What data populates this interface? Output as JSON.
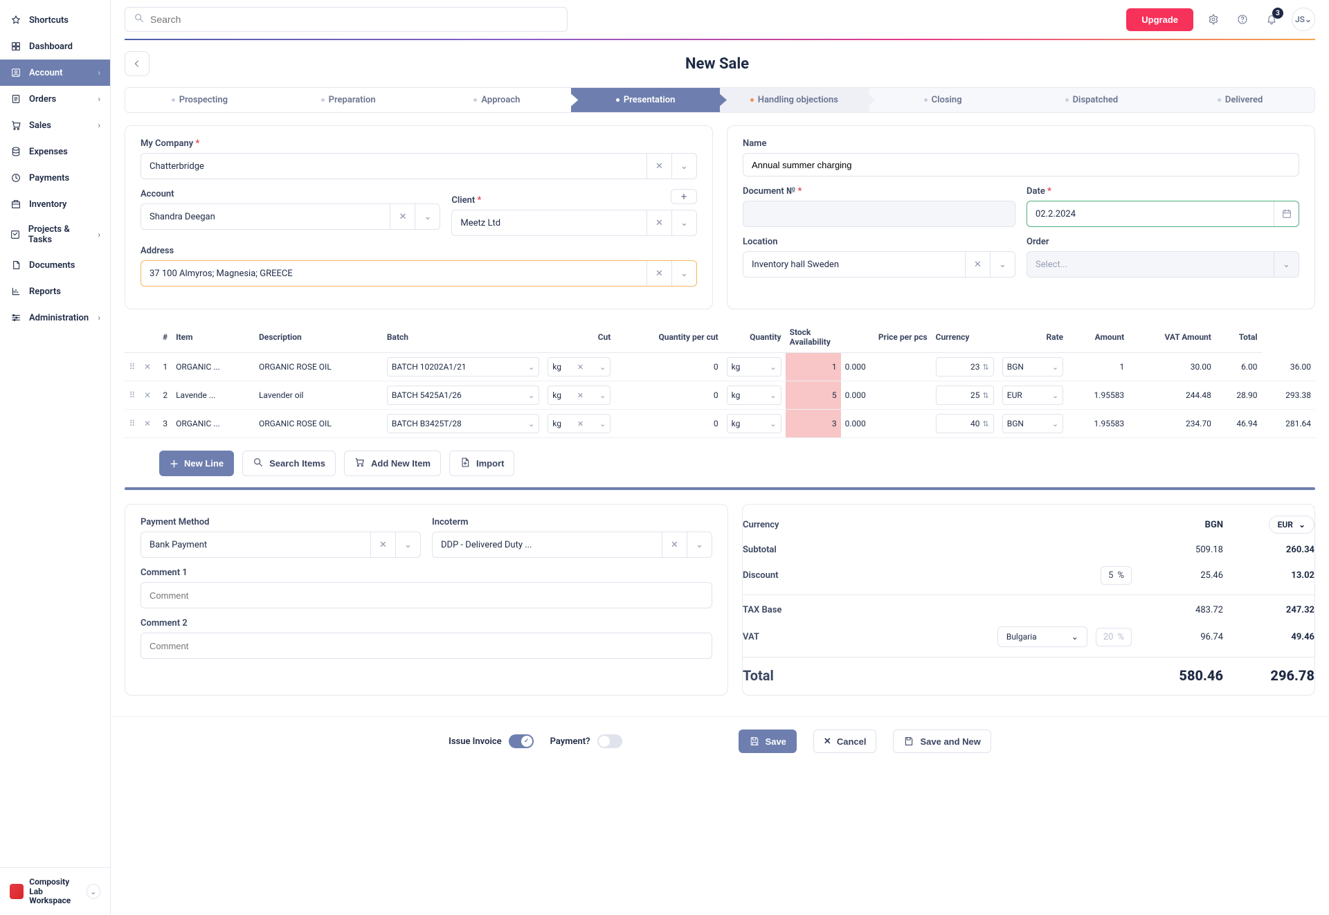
{
  "topbar": {
    "search_placeholder": "Search",
    "upgrade": "Upgrade",
    "notif_count": "3",
    "avatar": "JS"
  },
  "sidebar": {
    "items": [
      {
        "label": "Shortcuts",
        "has_children": false
      },
      {
        "label": "Dashboard",
        "has_children": false
      },
      {
        "label": "Account",
        "has_children": true,
        "active": true
      },
      {
        "label": "Orders",
        "has_children": true
      },
      {
        "label": "Sales",
        "has_children": true
      },
      {
        "label": "Expenses",
        "has_children": false
      },
      {
        "label": "Payments",
        "has_children": false
      },
      {
        "label": "Inventory",
        "has_children": false
      },
      {
        "label": "Projects & Tasks",
        "has_children": true
      },
      {
        "label": "Documents",
        "has_children": false
      },
      {
        "label": "Reports",
        "has_children": false
      },
      {
        "label": "Administration",
        "has_children": true
      }
    ],
    "workspace_line1": "Composity Lab",
    "workspace_line2": "Workspace"
  },
  "page": {
    "title": "New Sale"
  },
  "steps": [
    "Prospecting",
    "Preparation",
    "Approach",
    "Presentation",
    "Handling objections",
    "Closing",
    "Dispatched",
    "Delivered"
  ],
  "form": {
    "my_company_label": "My Company",
    "my_company_value": "Chatterbridge",
    "account_label": "Account",
    "account_value": "Shandra Deegan",
    "client_label": "Client",
    "client_value": "Meetz Ltd",
    "address_label": "Address",
    "address_value": "37 100 Almyros; Magnesia; GREECE",
    "name_label": "Name",
    "name_value": "Annual summer charging",
    "docno_label": "Document №",
    "docno_value": "",
    "date_label": "Date",
    "date_value": "02.2.2024",
    "location_label": "Location",
    "location_value": "Inventory hall Sweden",
    "order_label": "Order",
    "order_placeholder": "Select..."
  },
  "table": {
    "headers": {
      "num": "#",
      "item": "Item",
      "desc": "Description",
      "batch": "Batch",
      "cut": "Cut",
      "qpc": "Quantity per cut",
      "qty": "Quantity",
      "stock": "Stock Availability",
      "ppp": "Price per pcs",
      "curr": "Currency",
      "rate": "Rate",
      "amount": "Amount",
      "vat": "VAT Amount",
      "total": "Total"
    },
    "rows": [
      {
        "n": "1",
        "item": "ORGANIC ...",
        "desc": "ORGANIC ROSE OIL",
        "batch": "BATCH 10202A1/21",
        "cut": "kg",
        "qpc": "0",
        "qu": "kg",
        "qty": "1",
        "stock": "0.000",
        "ppp": "23",
        "curr": "BGN",
        "rate": "1",
        "amount": "30.00",
        "vat": "6.00",
        "total": "36.00"
      },
      {
        "n": "2",
        "item": "Lavende ...",
        "desc": "Lavender oil",
        "batch": "BATCH 5425A1/26",
        "cut": "kg",
        "qpc": "0",
        "qu": "kg",
        "qty": "5",
        "stock": "0.000",
        "ppp": "25",
        "curr": "EUR",
        "rate": "1.95583",
        "amount": "244.48",
        "vat": "28.90",
        "total": "293.38"
      },
      {
        "n": "3",
        "item": "ORGANIC ...",
        "desc": "ORGANIC ROSE OIL",
        "batch": "BATCH B3425T/28",
        "cut": "kg",
        "qpc": "0",
        "qu": "kg",
        "qty": "3",
        "stock": "0.000",
        "ppp": "40",
        "curr": "BGN",
        "rate": "1.95583",
        "amount": "234.70",
        "vat": "46.94",
        "total": "281.64"
      }
    ],
    "actions": {
      "new_line": "New Line",
      "search_items": "Search Items",
      "add_new_item": "Add New Item",
      "import": "Import"
    }
  },
  "payment": {
    "method_label": "Payment Method",
    "method_value": "Bank Payment",
    "incoterm_label": "Incoterm",
    "incoterm_value": "DDP - Delivered Duty ...",
    "c1_label": "Comment 1",
    "c1_placeholder": "Comment",
    "c2_label": "Comment 2",
    "c2_placeholder": "Comment"
  },
  "totals": {
    "currency_label": "Currency",
    "currency_main": "BGN",
    "currency_alt": "EUR",
    "subtotal_label": "Subtotal",
    "subtotal_a": "509.18",
    "subtotal_b": "260.34",
    "discount_label": "Discount",
    "discount_pct": "5",
    "discount_a": "25.46",
    "discount_b": "13.02",
    "taxbase_label": "TAX Base",
    "taxbase_a": "483.72",
    "taxbase_b": "247.32",
    "vat_label": "VAT",
    "vat_country": "Bulgaria",
    "vat_pct": "20",
    "vat_a": "96.74",
    "vat_b": "49.46",
    "total_label": "Total",
    "total_a": "580.46",
    "total_b": "296.78"
  },
  "footer": {
    "issue_invoice": "Issue Invoice",
    "payment_q": "Payment?",
    "save": "Save",
    "cancel": "Cancel",
    "save_new": "Save and New"
  }
}
